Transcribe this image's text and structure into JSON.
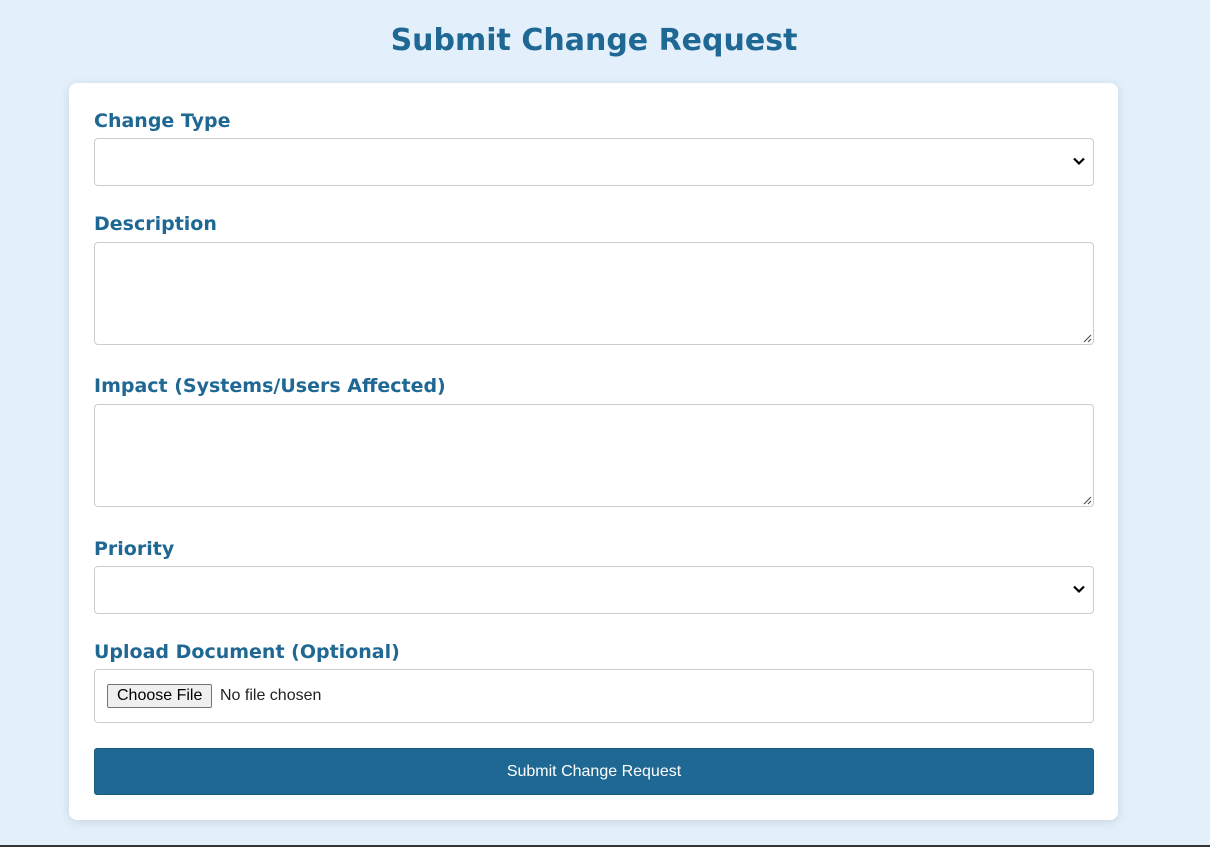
{
  "page": {
    "title": "Submit Change Request"
  },
  "form": {
    "change_type": {
      "label": "Change Type",
      "value": ""
    },
    "description": {
      "label": "Description",
      "value": ""
    },
    "impact": {
      "label": "Impact (Systems/Users Affected)",
      "value": ""
    },
    "priority": {
      "label": "Priority",
      "value": ""
    },
    "upload": {
      "label": "Upload Document (Optional)",
      "button_label": "Choose File",
      "status": "No file chosen"
    },
    "submit_label": "Submit Change Request"
  },
  "colors": {
    "background": "#e3f0fb",
    "accent": "#1f6893",
    "card": "#ffffff"
  },
  "icons": {
    "select_arrow": "chevron-down-icon",
    "textarea_grip": "resize-grip-icon"
  }
}
